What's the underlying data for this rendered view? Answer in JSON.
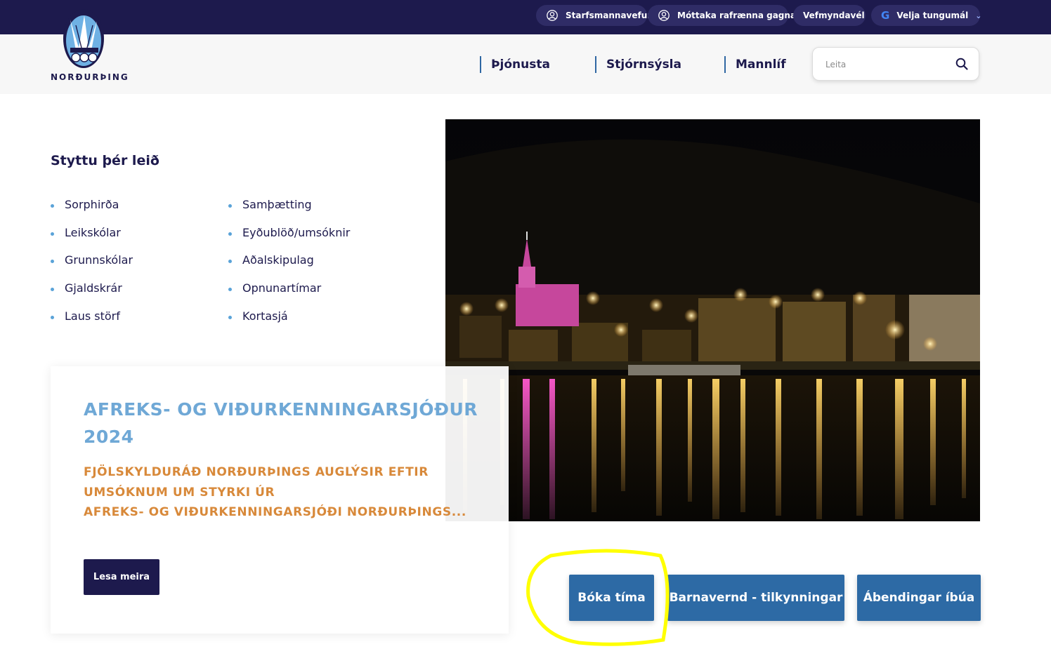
{
  "topbar": {
    "bg_color": "#1d1a4d",
    "links": [
      {
        "label": "Starfsmannavefur",
        "icon": "user-circle-icon"
      },
      {
        "label": "Móttaka rafrænna gagna",
        "icon": "user-circle-icon"
      },
      {
        "label": "Vefmyndavél"
      }
    ],
    "language": {
      "label": "Velja tungumál",
      "icon": "google-icon"
    }
  },
  "logo": {
    "text": "NORÐURÞING"
  },
  "nav": {
    "items": [
      "Þjónusta",
      "Stjórnsýsla",
      "Mannlíf"
    ],
    "accent_color": "#2f67a3"
  },
  "search": {
    "placeholder": "Leita",
    "icon": "search-icon"
  },
  "shortcuts": {
    "title": "Styttu þér leið",
    "col1": [
      "Sorphirða",
      "Leikskólar",
      "Grunnskólar",
      "Gjaldskrár",
      "Laus störf"
    ],
    "col2": [
      "Samþætting",
      "Eyðublöð/umsóknir",
      "Aðalskipulag",
      "Opnunartímar",
      "Kortasjá"
    ]
  },
  "hero": {
    "description_icon": "harbor-night-photo"
  },
  "news": {
    "title": "AFREKS- OG VIÐURKENNINGARSJÓÐUR 2024",
    "lines": [
      "FJÖLSKYLDURÁÐ NORÐURÞINGS AUGLÝSIR EFTIR",
      "UMSÓKNUM UM STYRKI ÚR",
      "AFREKS- OG VIÐURKENNINGARSJÓÐI NORÐURÞINGS..."
    ],
    "button": "Lesa meira",
    "title_color": "#6fa8d6",
    "text_color": "#d8893a"
  },
  "actions": [
    "Bóka tíma",
    "Barnavernd - tilkynningar",
    "Ábendingar íbúa"
  ],
  "colors": {
    "primary": "#1d1a4d",
    "action": "#2d6aa5",
    "highlight": "#ffff00"
  }
}
